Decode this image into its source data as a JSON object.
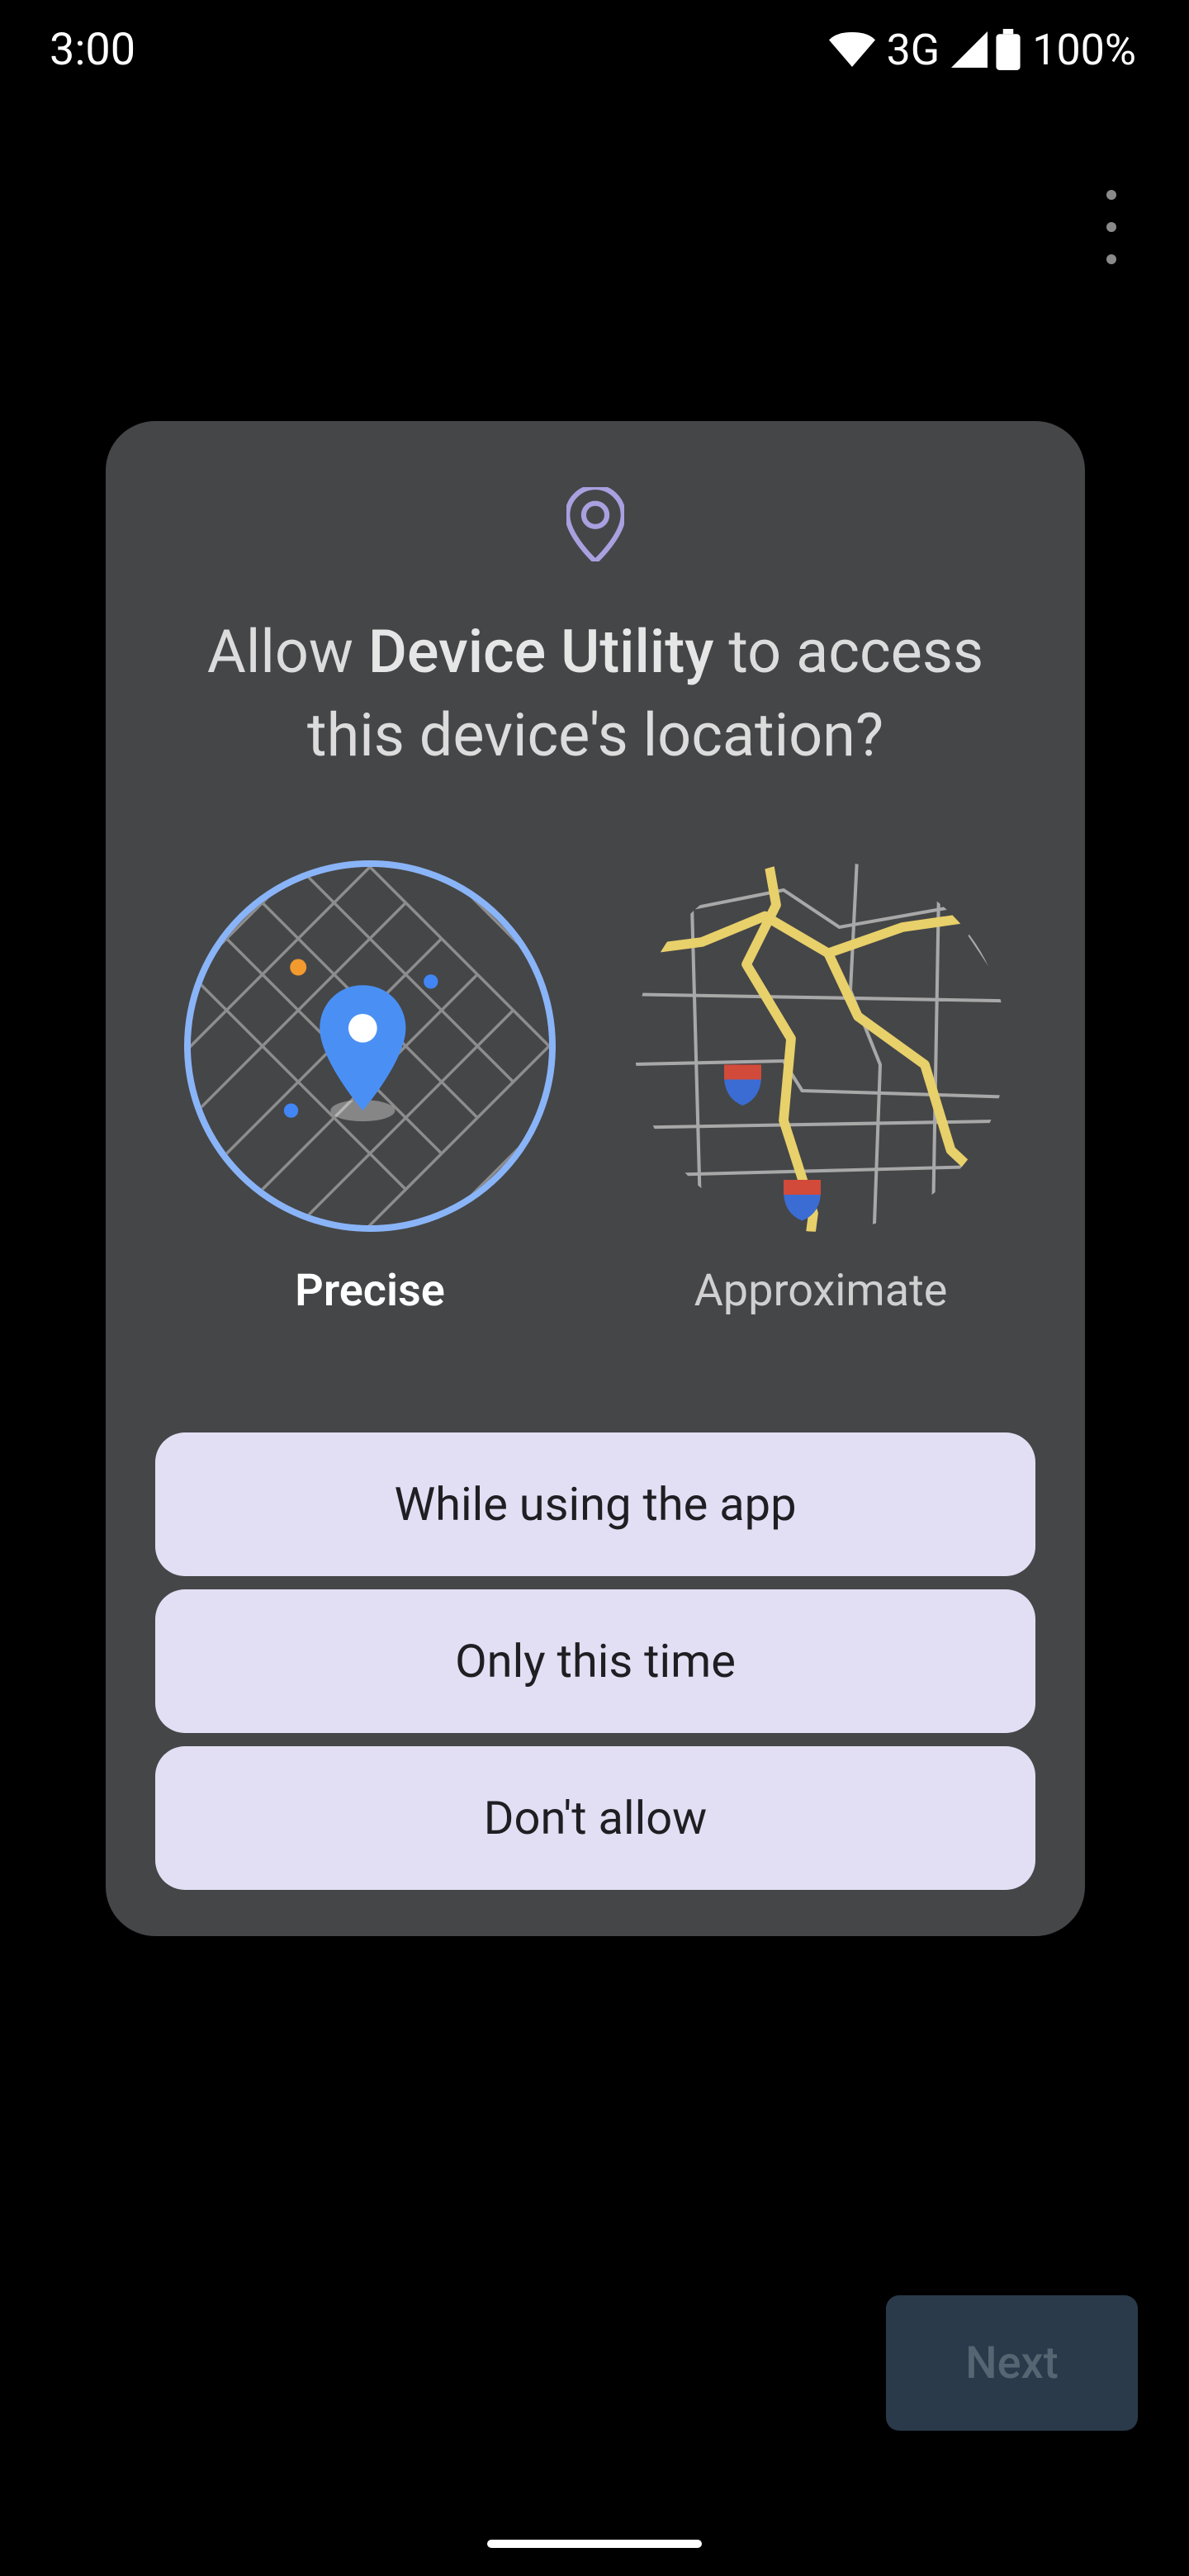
{
  "status_bar": {
    "time": "3:00",
    "network_type": "3G",
    "battery_percent": "100%"
  },
  "dialog": {
    "title_prefix": "Allow ",
    "app_name": "Device Utility",
    "title_suffix": " to access this device's location?",
    "accuracy": {
      "precise_label": "Precise",
      "approximate_label": "Approximate"
    },
    "buttons": {
      "while_using": "While using the app",
      "only_this_time": "Only this time",
      "dont_allow": "Don't allow"
    }
  },
  "footer": {
    "next_label": "Next"
  }
}
